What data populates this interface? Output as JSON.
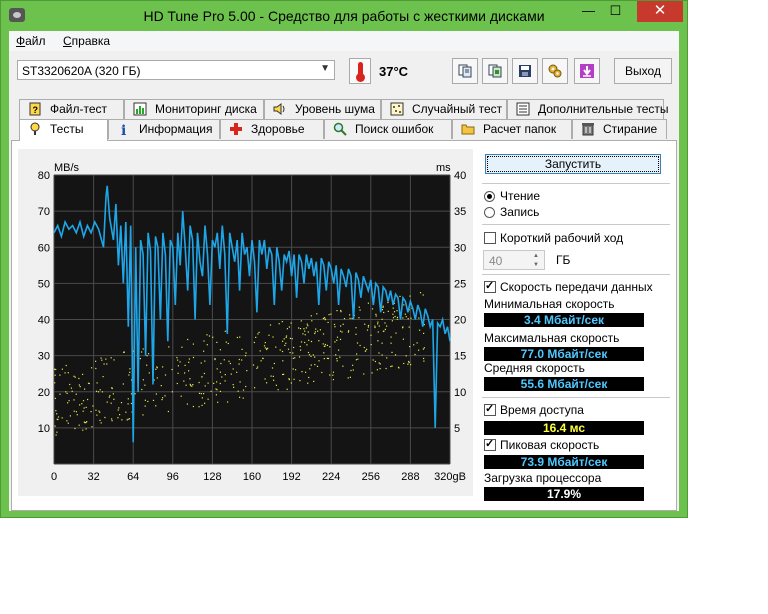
{
  "window": {
    "title": "HD Tune Pro 5.00 - Средство для работы с жесткими дисками",
    "minimize": "—",
    "maximize": "☐",
    "close": "✕"
  },
  "menu": [
    {
      "label": "Файл",
      "accel": "Ф",
      "rest": "айл"
    },
    {
      "label": "Справка",
      "accel": "С",
      "rest": "правка"
    }
  ],
  "toolbar": {
    "drive": "ST3320620A (320 ГБ)",
    "temperature": "37°C",
    "icons": [
      "copy-text-icon",
      "copy-screenshot-icon",
      "save-icon",
      "options-icon",
      "download-icon"
    ],
    "exit_label": "Выход"
  },
  "tabs_row1": [
    {
      "label": "Файл-тест",
      "icon": "file-test-icon"
    },
    {
      "label": "Мониторинг диска",
      "icon": "disk-monitor-icon"
    },
    {
      "label": "Уровень шума",
      "icon": "speaker-icon"
    },
    {
      "label": "Случайный тест",
      "icon": "random-test-icon"
    },
    {
      "label": "Дополнительные тесты",
      "icon": "extra-tests-icon"
    }
  ],
  "tabs_row2": [
    {
      "label": "Тесты",
      "icon": "benchmark-icon",
      "active": true
    },
    {
      "label": "Информация",
      "icon": "info-icon"
    },
    {
      "label": "Здоровье",
      "icon": "health-icon"
    },
    {
      "label": "Поиск ошибок",
      "icon": "error-scan-icon"
    },
    {
      "label": "Расчет папок",
      "icon": "folder-icon"
    },
    {
      "label": "Стирание",
      "icon": "erase-icon"
    }
  ],
  "controls": {
    "start_label": "Запустить",
    "read_label": "Чтение",
    "write_label": "Запись",
    "mode": "read",
    "short_stroke_label": "Короткий рабочий ход",
    "short_stroke_checked": false,
    "short_stroke_value": "40",
    "short_stroke_unit": "ГБ",
    "transfer_rate_label": "Скорость передачи данных",
    "transfer_rate_checked": true,
    "min_label": "Минимальная скорость",
    "min_value": "3.4 Мбайт/сек",
    "max_label": "Максимальная скорость",
    "max_value": "77.0 Мбайт/сек",
    "avg_label": "Средняя скорость",
    "avg_value": "55.6 Мбайт/сек",
    "access_time_label": "Время доступа",
    "access_time_checked": true,
    "access_time_value": "16.4 мс",
    "burst_label": "Пиковая скорость",
    "burst_checked": true,
    "burst_value": "73.9 Мбайт/сек",
    "cpu_label": "Загрузка процессора",
    "cpu_value": "17.9%",
    "value_color": "#4ec8ff",
    "access_color": "#ffff40",
    "cpu_color": "#ffffff"
  },
  "chart_data": {
    "type": "line",
    "left_unit": "MB/s",
    "right_unit": "ms",
    "x_ticks": [
      "0",
      "32",
      "64",
      "96",
      "128",
      "160",
      "192",
      "224",
      "256",
      "288",
      "320gB"
    ],
    "y_left_ticks": [
      "80",
      "70",
      "60",
      "50",
      "40",
      "30",
      "20",
      "10"
    ],
    "y_right_ticks": [
      "40",
      "35",
      "30",
      "25",
      "20",
      "15",
      "10",
      "5"
    ],
    "xlim": [
      0,
      320
    ],
    "ylim_left": [
      0,
      80
    ],
    "ylim_right": [
      0,
      40
    ],
    "grid": true,
    "transfer_color": "#1ea6e8",
    "access_color": "#e8e84a",
    "series": [
      {
        "values": [
          [
            0,
            64
          ],
          [
            3,
            66
          ],
          [
            6,
            63
          ],
          [
            9,
            67
          ],
          [
            12,
            65
          ],
          [
            15,
            66
          ],
          [
            18,
            64
          ],
          [
            21,
            67
          ],
          [
            24,
            63
          ],
          [
            27,
            66
          ],
          [
            30,
            64
          ],
          [
            33,
            67
          ],
          [
            36,
            65
          ],
          [
            40,
            60
          ],
          [
            42,
            74
          ],
          [
            43,
            77
          ],
          [
            45,
            68
          ],
          [
            48,
            62
          ],
          [
            50,
            72
          ],
          [
            52,
            55
          ],
          [
            54,
            66
          ],
          [
            56,
            50
          ],
          [
            58,
            67
          ],
          [
            60,
            38
          ],
          [
            62,
            66
          ],
          [
            64,
            6
          ],
          [
            66,
            60
          ],
          [
            68,
            20
          ],
          [
            70,
            62
          ],
          [
            72,
            58
          ],
          [
            74,
            30
          ],
          [
            76,
            64
          ],
          [
            78,
            59
          ],
          [
            80,
            22
          ],
          [
            82,
            63
          ],
          [
            84,
            60
          ],
          [
            86,
            40
          ],
          [
            88,
            64
          ],
          [
            90,
            58
          ],
          [
            92,
            34
          ],
          [
            94,
            62
          ],
          [
            96,
            60
          ],
          [
            98,
            44
          ],
          [
            100,
            64
          ],
          [
            102,
            55
          ],
          [
            104,
            70
          ],
          [
            106,
            60
          ],
          [
            108,
            48
          ],
          [
            110,
            66
          ],
          [
            112,
            62
          ],
          [
            114,
            40
          ],
          [
            116,
            64
          ],
          [
            118,
            56
          ],
          [
            120,
            52
          ],
          [
            122,
            66
          ],
          [
            124,
            58
          ],
          [
            126,
            44
          ],
          [
            128,
            62
          ],
          [
            130,
            60
          ],
          [
            132,
            64
          ],
          [
            134,
            54
          ],
          [
            136,
            66
          ],
          [
            138,
            58
          ],
          [
            140,
            36
          ],
          [
            142,
            64
          ],
          [
            144,
            60
          ],
          [
            146,
            56
          ],
          [
            148,
            62
          ],
          [
            150,
            48
          ],
          [
            152,
            64
          ],
          [
            154,
            58
          ],
          [
            156,
            60
          ],
          [
            158,
            52
          ],
          [
            160,
            62
          ],
          [
            162,
            56
          ],
          [
            164,
            42
          ],
          [
            166,
            62
          ],
          [
            168,
            58
          ],
          [
            170,
            62
          ],
          [
            172,
            54
          ],
          [
            174,
            60
          ],
          [
            176,
            58
          ],
          [
            178,
            44
          ],
          [
            180,
            60
          ],
          [
            182,
            56
          ],
          [
            184,
            48
          ],
          [
            186,
            58
          ],
          [
            188,
            56
          ],
          [
            190,
            59
          ],
          [
            192,
            52
          ],
          [
            194,
            58
          ],
          [
            196,
            46
          ],
          [
            198,
            58
          ],
          [
            200,
            56
          ],
          [
            202,
            50
          ],
          [
            204,
            58
          ],
          [
            206,
            54
          ],
          [
            208,
            57
          ],
          [
            210,
            52
          ],
          [
            212,
            56
          ],
          [
            214,
            44
          ],
          [
            216,
            57
          ],
          [
            218,
            55
          ],
          [
            220,
            48
          ],
          [
            222,
            56
          ],
          [
            224,
            54
          ],
          [
            226,
            50
          ],
          [
            228,
            55
          ],
          [
            230,
            44
          ],
          [
            232,
            54
          ],
          [
            234,
            52
          ],
          [
            236,
            49
          ],
          [
            238,
            54
          ],
          [
            240,
            52
          ],
          [
            242,
            40
          ],
          [
            244,
            53
          ],
          [
            246,
            51
          ],
          [
            248,
            46
          ],
          [
            250,
            52
          ],
          [
            252,
            50
          ],
          [
            254,
            48
          ],
          [
            256,
            51
          ],
          [
            258,
            44
          ],
          [
            260,
            50
          ],
          [
            262,
            49
          ],
          [
            264,
            42
          ],
          [
            266,
            49
          ],
          [
            268,
            48
          ],
          [
            270,
            45
          ],
          [
            272,
            48
          ],
          [
            274,
            44
          ],
          [
            276,
            47
          ],
          [
            278,
            46
          ],
          [
            280,
            40
          ],
          [
            282,
            46
          ],
          [
            284,
            45
          ],
          [
            286,
            42
          ],
          [
            288,
            45
          ],
          [
            290,
            43
          ],
          [
            292,
            40
          ],
          [
            294,
            44
          ],
          [
            296,
            42
          ],
          [
            298,
            38
          ],
          [
            300,
            43
          ],
          [
            302,
            41
          ],
          [
            304,
            38
          ],
          [
            306,
            40
          ],
          [
            308,
            10
          ],
          [
            310,
            39
          ],
          [
            312,
            38
          ],
          [
            314,
            40
          ],
          [
            316,
            36
          ],
          [
            318,
            38
          ],
          [
            320,
            34
          ]
        ]
      }
    ]
  }
}
